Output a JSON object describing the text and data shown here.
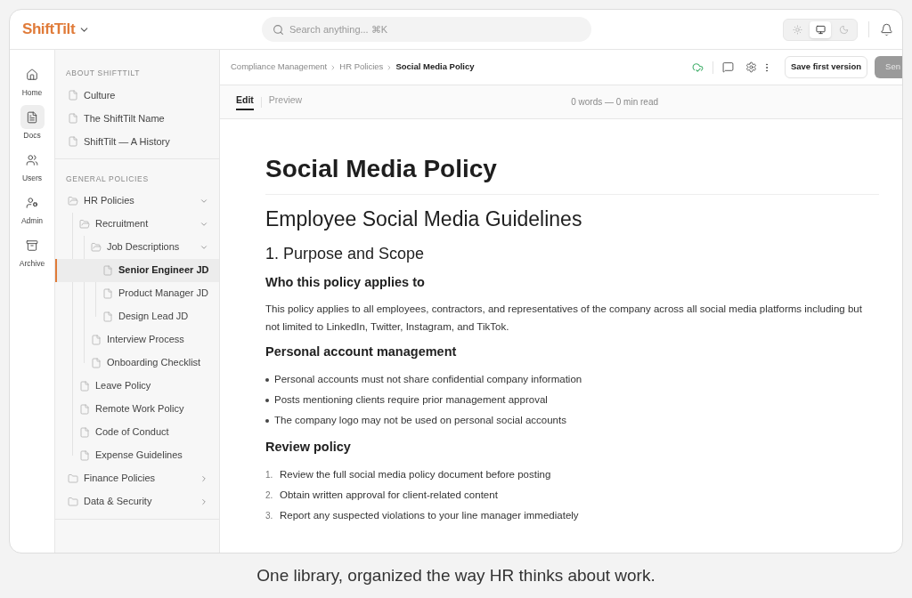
{
  "topbar": {
    "logo": "ShiftTilt",
    "search": {
      "placeholder": "Search anything... ⌘K"
    },
    "theme_modes": [
      {
        "kind": "light",
        "selected": false
      },
      {
        "kind": "system",
        "selected": true
      },
      {
        "kind": "dark",
        "selected": false
      }
    ]
  },
  "nav": [
    {
      "kind": "home",
      "label": "Home",
      "selected": false
    },
    {
      "kind": "docs",
      "label": "Docs",
      "selected": true
    },
    {
      "kind": "users",
      "label": "Users",
      "selected": false
    },
    {
      "kind": "admin",
      "label": "Admin",
      "selected": false
    },
    {
      "kind": "archive",
      "label": "Archive",
      "selected": false
    }
  ],
  "sidebar": {
    "sections": [
      {
        "title": "ABOUT SHIFTTILT",
        "items": [
          {
            "kind": "doc",
            "label": "Culture",
            "selected": false
          },
          {
            "kind": "doc",
            "label": "The ShiftTilt Name",
            "selected": false
          },
          {
            "kind": "doc",
            "label": "ShiftTilt — A History",
            "selected": false
          }
        ]
      },
      {
        "title": "GENERAL POLICIES",
        "items": [
          {
            "kind": "folder",
            "label": "HR Policies",
            "expanded": true,
            "children": [
              {
                "kind": "folder",
                "label": "Recruitment",
                "expanded": true,
                "children": [
                  {
                    "kind": "folder",
                    "label": "Job Descriptions",
                    "expanded": true,
                    "children": [
                      {
                        "kind": "doc",
                        "label": "Senior Engineer JD",
                        "selected": true
                      },
                      {
                        "kind": "doc",
                        "label": "Product Manager JD",
                        "selected": false
                      },
                      {
                        "kind": "doc",
                        "label": "Design Lead JD",
                        "selected": false
                      }
                    ]
                  },
                  {
                    "kind": "doc",
                    "label": "Interview Process",
                    "selected": false
                  },
                  {
                    "kind": "doc",
                    "label": "Onboarding Checklist",
                    "selected": false
                  }
                ]
              },
              {
                "kind": "doc",
                "label": "Leave Policy",
                "selected": false
              },
              {
                "kind": "doc",
                "label": "Remote Work Policy",
                "selected": false
              },
              {
                "kind": "doc",
                "label": "Code of Conduct",
                "selected": false
              },
              {
                "kind": "doc",
                "label": "Expense Guidelines",
                "selected": false
              }
            ]
          },
          {
            "kind": "folder",
            "label": "Finance Policies",
            "expanded": false
          },
          {
            "kind": "folder",
            "label": "Data & Security",
            "expanded": false
          }
        ]
      }
    ]
  },
  "breadcrumb": [
    "Compliance Management",
    "HR Policies",
    "Social Media Policy"
  ],
  "toolbar": {
    "synced": true,
    "buttons": [
      {
        "kind": "secondary",
        "label": "Save first version"
      },
      {
        "kind": "primary",
        "label": "Sen"
      }
    ]
  },
  "editor_tabs": [
    {
      "label": "Edit",
      "selected": true
    },
    {
      "label": "Preview",
      "selected": false
    }
  ],
  "word_count": "0 words — 0 min read",
  "document": [
    {
      "kind": "title",
      "text": "Social Media Policy"
    },
    {
      "kind": "h1",
      "text": "Employee Social Media Guidelines"
    },
    {
      "kind": "h2",
      "text": "1. Purpose and Scope"
    },
    {
      "kind": "h3",
      "text": "Who this policy applies to"
    },
    {
      "kind": "paragraph",
      "text": "This policy applies to all employees, contractors, and representatives of the company across all social media platforms including but not limited to LinkedIn, Twitter, Instagram, and TikTok."
    },
    {
      "kind": "h3",
      "text": "Personal account management"
    },
    {
      "kind": "bullets",
      "items": [
        "Personal accounts must not share confidential company information",
        "Posts mentioning clients require prior management approval",
        "The company logo may not be used on personal social accounts"
      ]
    },
    {
      "kind": "h3",
      "text": "Review policy"
    },
    {
      "kind": "numbered",
      "items": [
        {
          "number": "1.",
          "text": "Review the full social media policy document before posting"
        },
        {
          "number": "2.",
          "text": "Obtain written approval for client-related content"
        },
        {
          "number": "3.",
          "text": "Report any suspected violations to your line manager immediately"
        }
      ]
    }
  ],
  "caption": "One library, organized the way HR thinks about work."
}
